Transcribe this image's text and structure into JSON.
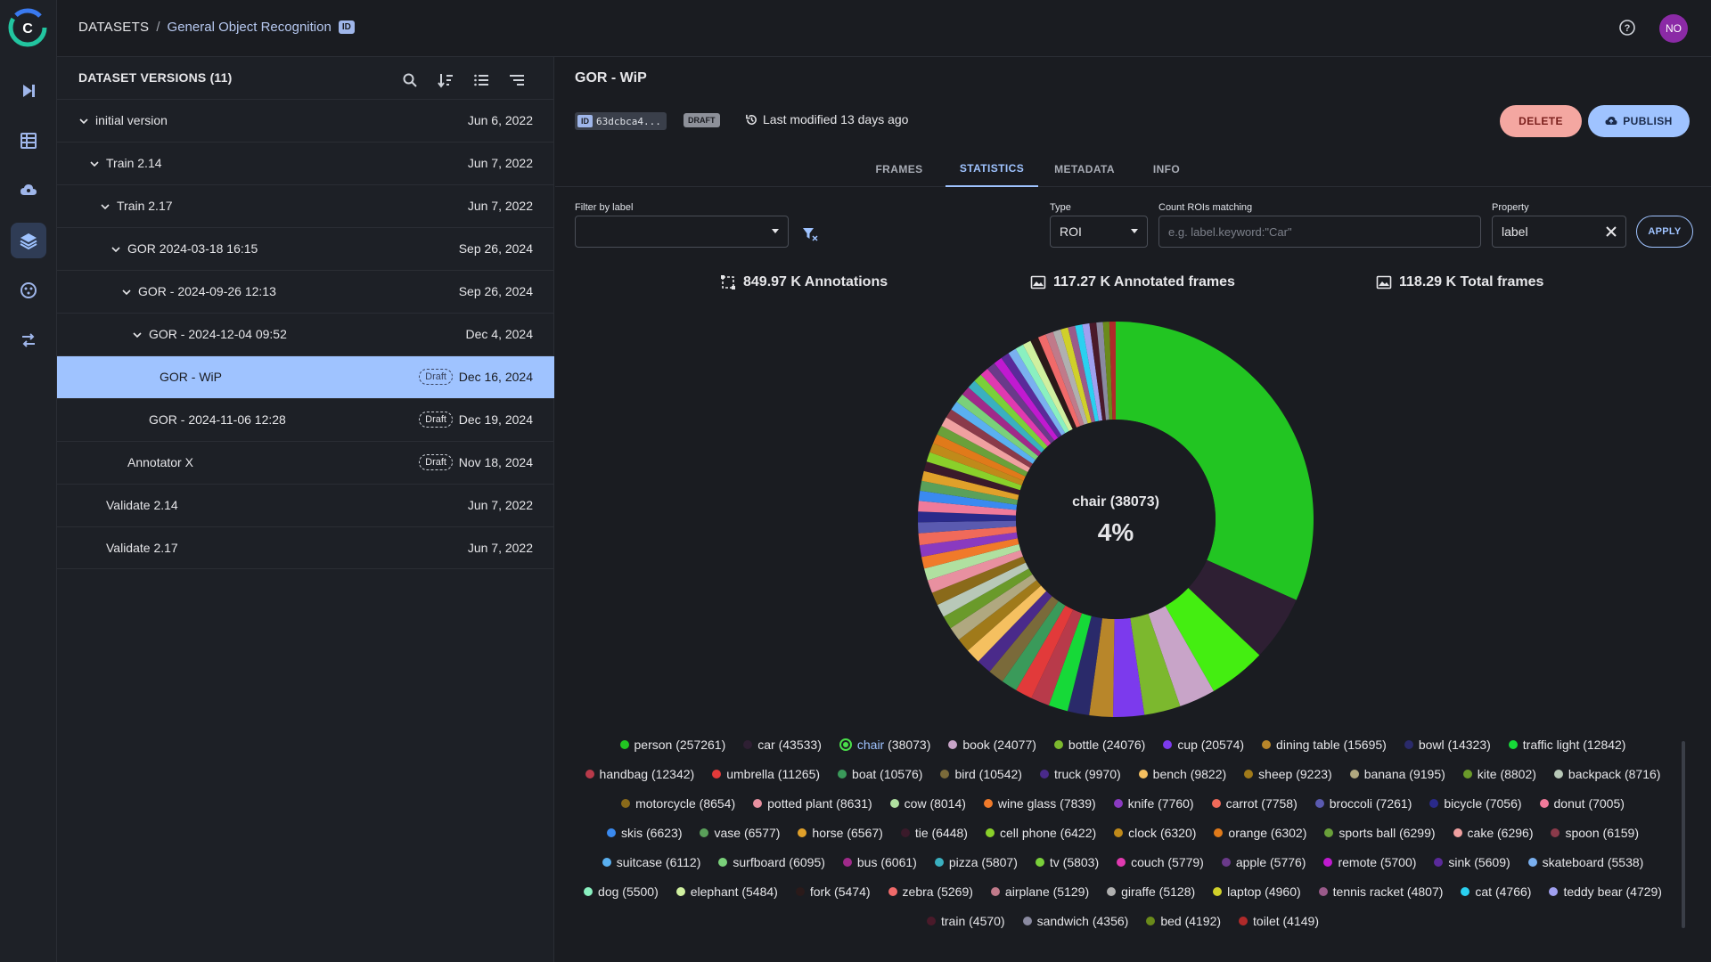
{
  "header": {
    "breadcrumb_root": "DATASETS",
    "breadcrumb_sep": "/",
    "breadcrumb_current": "General Object Recognition",
    "id_badge": "ID",
    "avatar_initials": "NO"
  },
  "versions_panel": {
    "title": "DATASET VERSIONS (11)",
    "versions": [
      {
        "name": "initial version",
        "date": "Jun 6, 2022",
        "draft": "",
        "indent": 0,
        "chevron": true
      },
      {
        "name": "Train 2.14",
        "date": "Jun 7, 2022",
        "draft": "",
        "indent": 1,
        "chevron": true
      },
      {
        "name": "Train 2.17",
        "date": "Jun 7, 2022",
        "draft": "",
        "indent": 2,
        "chevron": true
      },
      {
        "name": "GOR 2024-03-18 16:15",
        "date": "Sep 26, 2024",
        "draft": "",
        "indent": 3,
        "chevron": true
      },
      {
        "name": "GOR - 2024-09-26 12:13",
        "date": "Sep 26, 2024",
        "draft": "",
        "indent": 4,
        "chevron": true
      },
      {
        "name": "GOR - 2024-12-04 09:52",
        "date": "Dec 4, 2024",
        "draft": "",
        "indent": 5,
        "chevron": true
      },
      {
        "name": "GOR - WiP",
        "date": "Dec 16, 2024",
        "draft": "Draft",
        "indent": 6,
        "chevron": false,
        "selected": true
      },
      {
        "name": "GOR - 2024-11-06 12:28",
        "date": "Dec 19, 2024",
        "draft": "Draft",
        "indent": 5,
        "chevron": false
      },
      {
        "name": "Annotator X",
        "date": "Nov 18, 2024",
        "draft": "Draft",
        "indent": 3,
        "chevron": false
      },
      {
        "name": "Validate 2.14",
        "date": "Jun 7, 2022",
        "draft": "",
        "indent": 1,
        "chevron": false
      },
      {
        "name": "Validate 2.17",
        "date": "Jun 7, 2022",
        "draft": "",
        "indent": 1,
        "chevron": false
      }
    ]
  },
  "main": {
    "title": "GOR - WiP",
    "id_label": "ID",
    "id_value": "63dcbca4...",
    "status": "DRAFT",
    "last_modified": "Last modified 13 days ago",
    "delete_label": "DELETE",
    "publish_label": "PUBLISH",
    "tabs": [
      "FRAMES",
      "STATISTICS",
      "METADATA",
      "INFO"
    ],
    "active_tab": "STATISTICS",
    "filters": {
      "filter_by_label": "Filter by label",
      "type_label": "Type",
      "type_value": "ROI",
      "count_label": "Count ROIs matching",
      "count_placeholder": "e.g. label.keyword:\"Car\"",
      "property_label": "Property",
      "property_value": "label",
      "apply_label": "APPLY"
    },
    "stats": {
      "annotations": "849.97 K Annotations",
      "annotated_frames": "117.27 K Annotated frames",
      "total_frames": "118.29 K Total frames"
    },
    "pie_center_label": "chair (38073)",
    "pie_center_value": "4%"
  },
  "chart_data": {
    "type": "pie",
    "highlighted": "chair",
    "series": [
      {
        "label": "person",
        "value": 257261,
        "color": "#22c522"
      },
      {
        "label": "car",
        "value": 43533,
        "color": "#2e1f33"
      },
      {
        "label": "chair",
        "value": 38073,
        "color": "#44ee11"
      },
      {
        "label": "book",
        "value": 24077,
        "color": "#c8a4c8"
      },
      {
        "label": "bottle",
        "value": 24076,
        "color": "#7cb82e"
      },
      {
        "label": "cup",
        "value": 20574,
        "color": "#7c3aed"
      },
      {
        "label": "dining table",
        "value": 15695,
        "color": "#b8862a"
      },
      {
        "label": "bowl",
        "value": 14323,
        "color": "#2a2a6a"
      },
      {
        "label": "traffic light",
        "value": 12842,
        "color": "#16d938"
      },
      {
        "label": "handbag",
        "value": 12342,
        "color": "#b83a4a"
      },
      {
        "label": "umbrella",
        "value": 11265,
        "color": "#e23a3a"
      },
      {
        "label": "boat",
        "value": 10576,
        "color": "#3a9a5a"
      },
      {
        "label": "bird",
        "value": 10542,
        "color": "#7a6a3a"
      },
      {
        "label": "truck",
        "value": 9970,
        "color": "#4a2a8a"
      },
      {
        "label": "bench",
        "value": 9822,
        "color": "#f5c060"
      },
      {
        "label": "sheep",
        "value": 9223,
        "color": "#a07a1a"
      },
      {
        "label": "banana",
        "value": 9195,
        "color": "#b0a880"
      },
      {
        "label": "kite",
        "value": 8802,
        "color": "#6a9a2a"
      },
      {
        "label": "backpack",
        "value": 8716,
        "color": "#b8c8b8"
      },
      {
        "label": "motorcycle",
        "value": 8654,
        "color": "#8a6a1a"
      },
      {
        "label": "potted plant",
        "value": 8631,
        "color": "#e890a0"
      },
      {
        "label": "cow",
        "value": 8014,
        "color": "#b0e0a0"
      },
      {
        "label": "wine glass",
        "value": 7839,
        "color": "#f07a2a"
      },
      {
        "label": "knife",
        "value": 7760,
        "color": "#8a3ac0"
      },
      {
        "label": "carrot",
        "value": 7758,
        "color": "#f06a5a"
      },
      {
        "label": "broccoli",
        "value": 7261,
        "color": "#5a5ab0"
      },
      {
        "label": "bicycle",
        "value": 7056,
        "color": "#2a2a8a"
      },
      {
        "label": "donut",
        "value": 7005,
        "color": "#f07a9a"
      },
      {
        "label": "skis",
        "value": 6623,
        "color": "#3a8af0"
      },
      {
        "label": "vase",
        "value": 6577,
        "color": "#5aa05a"
      },
      {
        "label": "horse",
        "value": 6567,
        "color": "#e0a02a"
      },
      {
        "label": "tie",
        "value": 6448,
        "color": "#3a1a2a"
      },
      {
        "label": "cell phone",
        "value": 6422,
        "color": "#8ad02a"
      },
      {
        "label": "clock",
        "value": 6320,
        "color": "#c08a1a"
      },
      {
        "label": "orange",
        "value": 6302,
        "color": "#e07a1a"
      },
      {
        "label": "sports ball",
        "value": 6299,
        "color": "#6aa03a"
      },
      {
        "label": "cake",
        "value": 6296,
        "color": "#f0a0a0"
      },
      {
        "label": "spoon",
        "value": 6159,
        "color": "#8a3a4a"
      },
      {
        "label": "suitcase",
        "value": 6112,
        "color": "#5ab0f0"
      },
      {
        "label": "surfboard",
        "value": 6095,
        "color": "#7ad07a"
      },
      {
        "label": "bus",
        "value": 6061,
        "color": "#a02a8a"
      },
      {
        "label": "pizza",
        "value": 5807,
        "color": "#3ab0c0"
      },
      {
        "label": "tv",
        "value": 5803,
        "color": "#7ad03a"
      },
      {
        "label": "couch",
        "value": 5779,
        "color": "#e03ab0"
      },
      {
        "label": "apple",
        "value": 5776,
        "color": "#6a3a8a"
      },
      {
        "label": "remote",
        "value": 5700,
        "color": "#c01ad0"
      },
      {
        "label": "sink",
        "value": 5609,
        "color": "#5a2a9a"
      },
      {
        "label": "skateboard",
        "value": 5538,
        "color": "#7ab0f0"
      },
      {
        "label": "dog",
        "value": 5500,
        "color": "#8af0c0"
      },
      {
        "label": "elephant",
        "value": 5484,
        "color": "#d0f0a0"
      },
      {
        "label": "fork",
        "value": 5474,
        "color": "#2a1a1a"
      },
      {
        "label": "zebra",
        "value": 5269,
        "color": "#f06a6a"
      },
      {
        "label": "airplane",
        "value": 5129,
        "color": "#c07a8a"
      },
      {
        "label": "giraffe",
        "value": 5128,
        "color": "#b0b0b0"
      },
      {
        "label": "laptop",
        "value": 4960,
        "color": "#d0d02a"
      },
      {
        "label": "tennis racket",
        "value": 4807,
        "color": "#9a5a8a"
      },
      {
        "label": "cat",
        "value": 4766,
        "color": "#2ad0f0"
      },
      {
        "label": "teddy bear",
        "value": 4729,
        "color": "#a0a0f0"
      },
      {
        "label": "train",
        "value": 4570,
        "color": "#4a1a2a"
      },
      {
        "label": "sandwich",
        "value": 4356,
        "color": "#8a8aa0"
      },
      {
        "label": "bed",
        "value": 4192,
        "color": "#6a8a1a"
      },
      {
        "label": "toilet",
        "value": 4149,
        "color": "#b02a2a"
      }
    ]
  }
}
